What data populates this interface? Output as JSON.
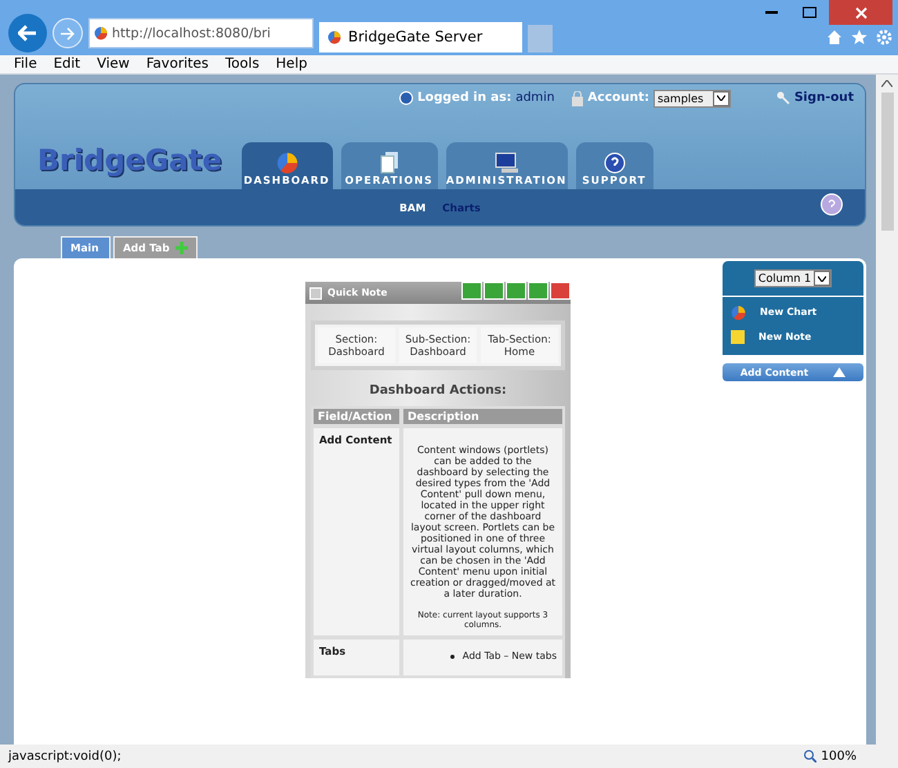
{
  "browser": {
    "address": "http://localhost:8080/bri",
    "tab_title": "BridgeGate Server"
  },
  "menu": [
    "File",
    "Edit",
    "View",
    "Favorites",
    "Tools",
    "Help"
  ],
  "header": {
    "logo": "BridgeGate",
    "logged_in_label": "Logged in as:",
    "user": "admin",
    "account_label": "Account:",
    "account": "samples",
    "sign_out": "Sign-out"
  },
  "nav": [
    {
      "label": "DASHBOARD",
      "selected": true
    },
    {
      "label": "OPERATIONS",
      "selected": false
    },
    {
      "label": "ADMINISTRATION",
      "selected": false
    },
    {
      "label": "SUPPORT",
      "selected": false
    }
  ],
  "subnav": [
    {
      "label": "BAM",
      "selected": true
    },
    {
      "label": "Charts",
      "selected": false
    }
  ],
  "page_tabs": [
    {
      "label": "Main",
      "kind": "tab",
      "selected": true
    },
    {
      "label": "Add Tab",
      "kind": "add",
      "selected": false
    }
  ],
  "portlet": {
    "title": "Quick Note",
    "sections": [
      "Section: Dashboard",
      "Sub-Section: Dashboard",
      "Tab-Section: Home"
    ],
    "heading": "Dashboard Actions:",
    "columns": [
      "Field/Action",
      "Description"
    ],
    "rows": [
      {
        "field": "Add Content",
        "description": "Content windows (portlets) can be added to the dashboard by selecting the desired types from the 'Add Content' pull down menu, located in the upper right corner of the dashboard layout screen. Portlets can be positioned in one of three virtual layout columns, which can be chosen in the 'Add Content' menu upon initial creation or dragged/moved at a later duration.",
        "note": "Note: current layout supports 3 columns."
      },
      {
        "field": "Tabs",
        "bullets": [
          "Add Tab – New tabs"
        ]
      }
    ]
  },
  "add_content": {
    "column": "Column 1",
    "items": [
      {
        "label": "New Chart"
      },
      {
        "label": "New Note"
      }
    ],
    "button": "Add Content"
  },
  "status": {
    "text": "javascript:void(0);",
    "zoom": "100%"
  }
}
